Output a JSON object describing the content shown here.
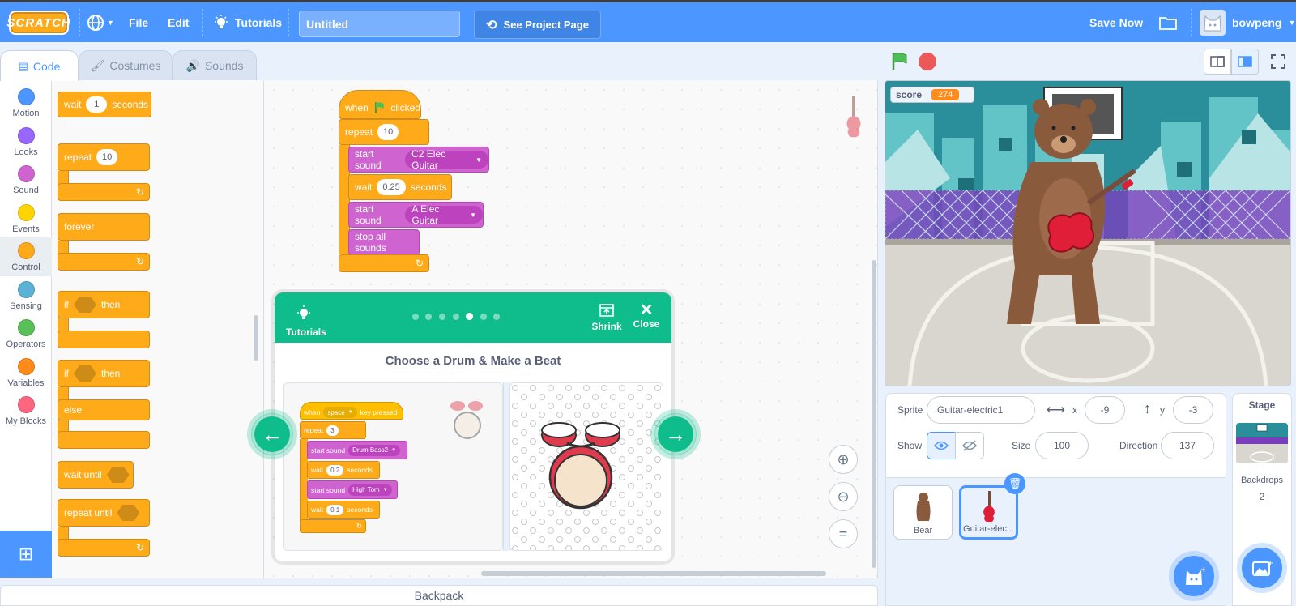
{
  "menubar": {
    "logo": "SCRATCH",
    "file": "File",
    "edit": "Edit",
    "tutorials": "Tutorials",
    "project_title": "Untitled",
    "see_project": "See Project Page",
    "save_now": "Save Now",
    "username": "bowpeng"
  },
  "tabs": {
    "code": "Code",
    "costumes": "Costumes",
    "sounds": "Sounds"
  },
  "categories": [
    {
      "label": "Motion",
      "color": "#4c97ff"
    },
    {
      "label": "Looks",
      "color": "#9966ff"
    },
    {
      "label": "Sound",
      "color": "#cf63cf"
    },
    {
      "label": "Events",
      "color": "#ffd500"
    },
    {
      "label": "Control",
      "color": "#ffab19"
    },
    {
      "label": "Sensing",
      "color": "#5cb1d6"
    },
    {
      "label": "Operators",
      "color": "#59c059"
    },
    {
      "label": "Variables",
      "color": "#ff8c1a"
    },
    {
      "label": "My Blocks",
      "color": "#ff6680"
    }
  ],
  "palette": {
    "wait": "wait",
    "wait_value": "1",
    "seconds": "seconds",
    "repeat": "repeat",
    "repeat_value": "10",
    "forever": "forever",
    "if": "if",
    "then": "then",
    "if2": "if",
    "then2": "then",
    "else": "else",
    "wait_until": "wait until",
    "repeat_until": "repeat until"
  },
  "script": {
    "when": "when",
    "clicked": "clicked",
    "repeat": "repeat",
    "repeat_value": "10",
    "start_sound_1": "start sound",
    "sound_1": "C2 Elec Guitar",
    "wait": "wait",
    "wait_value": "0.25",
    "seconds": "seconds",
    "start_sound_2": "start sound",
    "sound_2": "A Elec Guitar",
    "stop_all": "stop all sounds"
  },
  "tutorial": {
    "tutorials_label": "Tutorials",
    "shrink": "Shrink",
    "close": "Close",
    "title": "Choose a Drum & Make a Beat",
    "mini": {
      "when": "when",
      "key": "space",
      "key_pressed": "key pressed",
      "repeat": "repeat",
      "repeat_value": "3",
      "start_sound_1": "start sound",
      "sound_1": "Drum Bass2",
      "wait_1": "wait",
      "wait_value_1": "0.2",
      "seconds_1": "seconds",
      "start_sound_2": "start sound",
      "sound_2": "High Tom",
      "wait_2": "wait",
      "wait_value_2": "0.1",
      "seconds_2": "seconds"
    }
  },
  "backpack": "Backpack",
  "stage": {
    "monitor_label": "score",
    "monitor_value": "274"
  },
  "sprite_info": {
    "sprite_label": "Sprite",
    "sprite_name": "Guitar-electric1",
    "x_label": "x",
    "x_value": "-9",
    "y_label": "y",
    "y_value": "-3",
    "show_label": "Show",
    "size_label": "Size",
    "size_value": "100",
    "direction_label": "Direction",
    "direction_value": "137"
  },
  "sprites": [
    {
      "name": "Bear"
    },
    {
      "name": "Guitar-elec..."
    }
  ],
  "stage_panel": {
    "title": "Stage",
    "backdrops_label": "Backdrops",
    "backdrops_count": "2"
  }
}
